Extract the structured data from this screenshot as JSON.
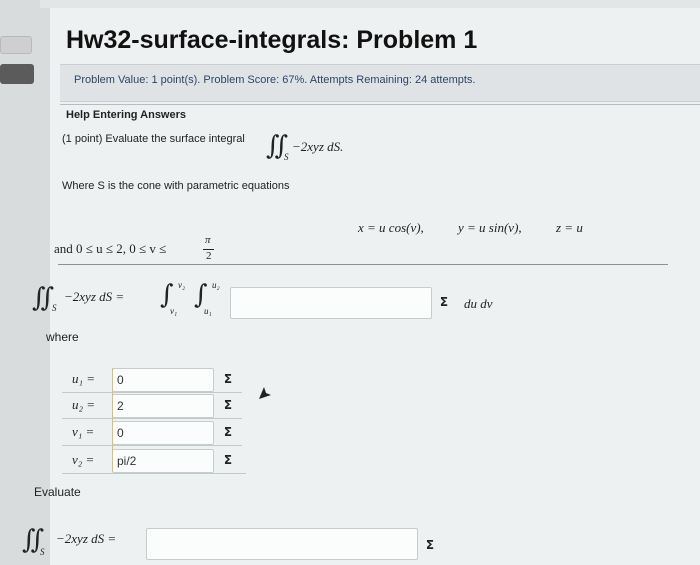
{
  "page": {
    "title": "Hw32-surface-integrals: Problem 1",
    "problem_value": "Problem Value: 1 point(s). Problem Score: 67%. Attempts Remaining: 24 attempts.",
    "help_link": "Help Entering Answers",
    "prompt": "(1 point) Evaluate the surface integral",
    "prompt_integrand": "−2xyz dS.",
    "where_s": "Where S is the cone with parametric equations",
    "param_x": "x = u cos(v),",
    "param_y": "y = u sin(v),",
    "param_z": "z = u",
    "bounds_text": "and 0 ≤ u ≤ 2, 0 ≤ v ≤",
    "bounds_frac_num": "π",
    "bounds_frac_den": "2",
    "integral_lhs": "−2xyz dS =",
    "upper_v": "v₂",
    "lower_v": "v₁",
    "upper_u": "u₂",
    "lower_u": "u₁",
    "du_dv": "du dv",
    "where_label": "where",
    "evaluate_label": "Evaluate",
    "integral_S": "S",
    "answer_sigma": "Σ"
  },
  "limits": [
    {
      "label": "u₁ =",
      "value": "0"
    },
    {
      "label": "u₂ =",
      "value": "2"
    },
    {
      "label": "v₁ =",
      "value": "0"
    },
    {
      "label": "v₂ =",
      "value": "pi/2"
    }
  ],
  "answers": {
    "integrand_box": "",
    "final_box": ""
  }
}
